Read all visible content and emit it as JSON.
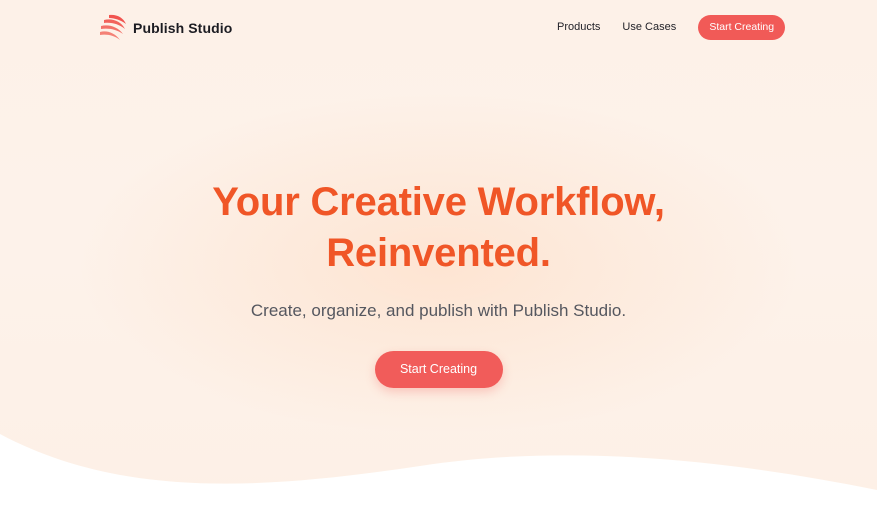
{
  "brand": {
    "name": "Publish Studio",
    "logo_icon": "layered-pages-logo-icon",
    "accent": "#f15a57"
  },
  "nav": {
    "links": [
      "Products",
      "Use Cases"
    ],
    "cta_label": "Start Creating"
  },
  "hero": {
    "title_line1": "Your Creative Workflow,",
    "title_line2": "Reinvented.",
    "subtitle": "Create, organize, and publish with Publish Studio.",
    "cta_label": "Start Creating",
    "title_color": "#f05627",
    "cta_color": "#f15c5a"
  }
}
